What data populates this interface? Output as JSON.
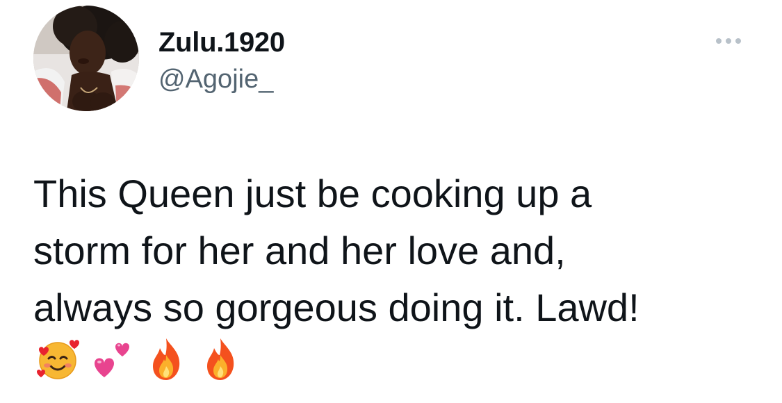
{
  "author": {
    "display_name": "Zulu.1920",
    "handle": "@Agojie_"
  },
  "tweet": {
    "text_lines": [
      "This Queen just be cooking up a",
      "storm for her and her love and,",
      "always so gorgeous doing it. Lawd!"
    ],
    "emojis": [
      "smiling-face-with-hearts",
      "two-hearts",
      "fire",
      "fire"
    ]
  },
  "colors": {
    "text_primary": "#0f1419",
    "text_secondary": "#536471",
    "more_dots": "#b8c1c9",
    "background": "#ffffff"
  },
  "icons": {
    "more": "more-horizontal-icon"
  }
}
